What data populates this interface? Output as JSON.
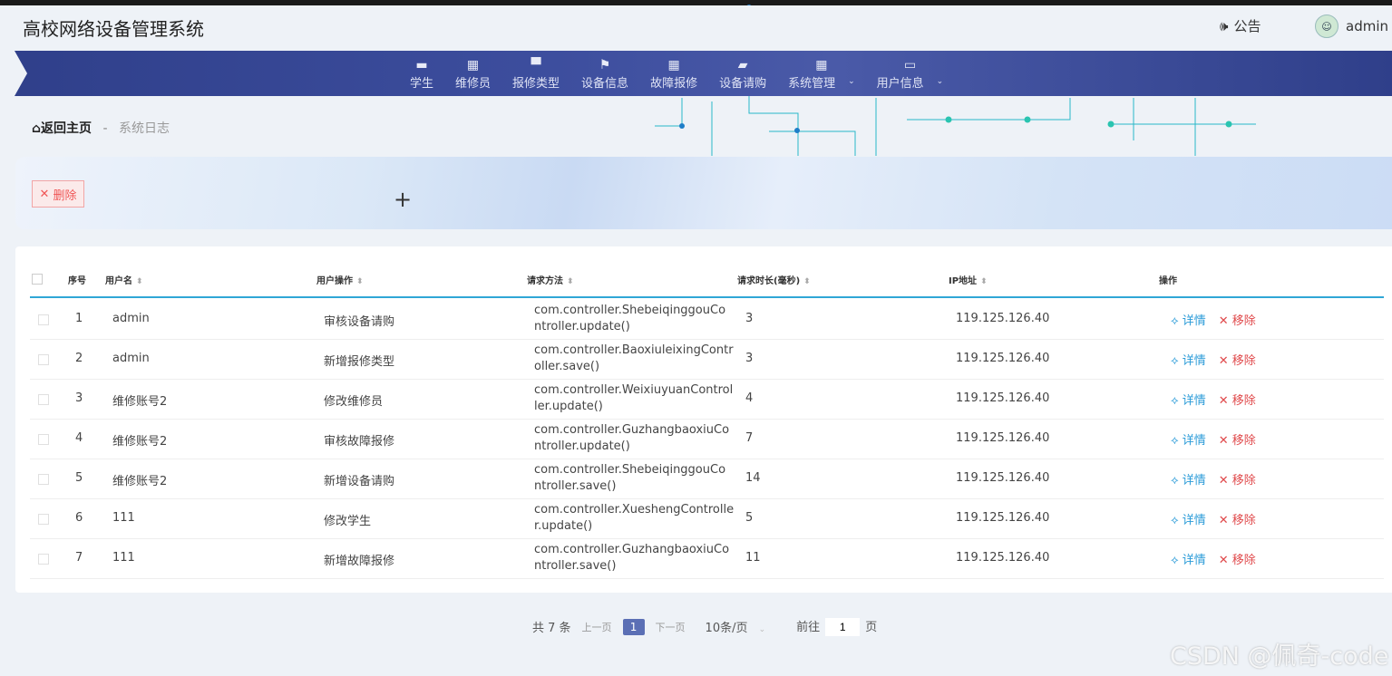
{
  "app": {
    "title": "高校网络设备管理系统"
  },
  "header": {
    "notice_label": "公告",
    "user_name": "admin"
  },
  "nav": {
    "items": [
      {
        "label": "学生",
        "icon": "briefcase-icon"
      },
      {
        "label": "维修员",
        "icon": "grid-icon"
      },
      {
        "label": "报修类型",
        "icon": "monitor-icon"
      },
      {
        "label": "设备信息",
        "icon": "flag-icon"
      },
      {
        "label": "故障报修",
        "icon": "grid-icon"
      },
      {
        "label": "设备请购",
        "icon": "ticket-icon"
      },
      {
        "label": "系统管理",
        "icon": "grid-icon"
      },
      {
        "label": "用户信息",
        "icon": "card-icon"
      }
    ]
  },
  "breadcrumb": {
    "home": "返回主页",
    "sep": "-",
    "current": "系统日志"
  },
  "toolbar": {
    "delete_label": "删除"
  },
  "table": {
    "headers": {
      "index": "序号",
      "username": "用户名",
      "operation": "用户操作",
      "method": "请求方法",
      "duration": "请求时长(毫秒)",
      "ip": "IP地址",
      "actions": "操作"
    },
    "detail_label": "详情",
    "remove_label": "移除",
    "rows": [
      {
        "index": "1",
        "username": "admin",
        "operation": "审核设备请购",
        "method1": "com.controller.ShebeiqinggouCo",
        "method2": "ntroller.update()",
        "duration": "3",
        "ip": "119.125.126.40"
      },
      {
        "index": "2",
        "username": "admin",
        "operation": "新增报修类型",
        "method1": "com.controller.BaoxiuleixingContr",
        "method2": "oller.save()",
        "duration": "3",
        "ip": "119.125.126.40"
      },
      {
        "index": "3",
        "username": "维修账号2",
        "operation": "修改维修员",
        "method1": "com.controller.WeixiuyuanControl",
        "method2": "ler.update()",
        "duration": "4",
        "ip": "119.125.126.40"
      },
      {
        "index": "4",
        "username": "维修账号2",
        "operation": "审核故障报修",
        "method1": "com.controller.GuzhangbaoxiuCo",
        "method2": "ntroller.update()",
        "duration": "7",
        "ip": "119.125.126.40"
      },
      {
        "index": "5",
        "username": "维修账号2",
        "operation": "新增设备请购",
        "method1": "com.controller.ShebeiqinggouCo",
        "method2": "ntroller.save()",
        "duration": "14",
        "ip": "119.125.126.40"
      },
      {
        "index": "6",
        "username": "111",
        "operation": "修改学生",
        "method1": "com.controller.XueshengControlle",
        "method2": "r.update()",
        "duration": "5",
        "ip": "119.125.126.40"
      },
      {
        "index": "7",
        "username": "111",
        "operation": "新增故障报修",
        "method1": "com.controller.GuzhangbaoxiuCo",
        "method2": "ntroller.save()",
        "duration": "11",
        "ip": "119.125.126.40"
      }
    ]
  },
  "pager": {
    "total": "共 7 条",
    "prev": "上一页",
    "current": "1",
    "next": "下一页",
    "size": "10条/页",
    "goto_prefix": "前往",
    "goto_value": "1",
    "goto_suffix": "页"
  },
  "watermark": "CSDN @佩奇-code"
}
